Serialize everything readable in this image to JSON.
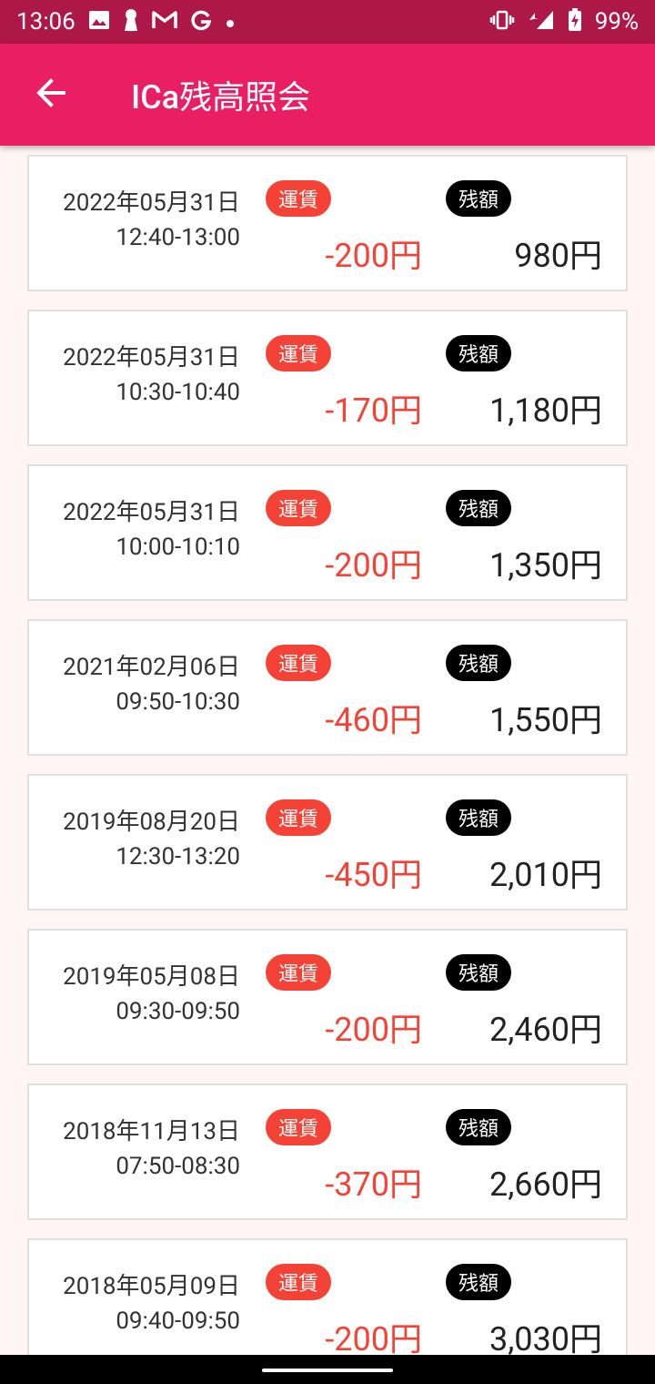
{
  "status_bar": {
    "time": "13:06",
    "battery": "99%",
    "left_icons": [
      "image-icon",
      "keyhole-icon",
      "gmail-icon",
      "google-icon",
      "dot-icon"
    ],
    "right_icons": [
      "vibrate-icon",
      "signal-icon",
      "battery-charging-icon"
    ]
  },
  "app_bar": {
    "title": "ICa残高照会",
    "back_icon": "arrow-left-icon"
  },
  "labels": {
    "fare": "運賃",
    "balance": "残額"
  },
  "colors": {
    "status_bar": "#ad1848",
    "app_bar": "#e91e63",
    "fare_red": "#f44336",
    "background": "#fff5f5"
  },
  "transactions": [
    {
      "date": "2022年05月31日",
      "time": "12:40-13:00",
      "fare": "-200円",
      "balance": "980円"
    },
    {
      "date": "2022年05月31日",
      "time": "10:30-10:40",
      "fare": "-170円",
      "balance": "1,180円"
    },
    {
      "date": "2022年05月31日",
      "time": "10:00-10:10",
      "fare": "-200円",
      "balance": "1,350円"
    },
    {
      "date": "2021年02月06日",
      "time": "09:50-10:30",
      "fare": "-460円",
      "balance": "1,550円"
    },
    {
      "date": "2019年08月20日",
      "time": "12:30-13:20",
      "fare": "-450円",
      "balance": "2,010円"
    },
    {
      "date": "2019年05月08日",
      "time": "09:30-09:50",
      "fare": "-200円",
      "balance": "2,460円"
    },
    {
      "date": "2018年11月13日",
      "time": "07:50-08:30",
      "fare": "-370円",
      "balance": "2,660円"
    },
    {
      "date": "2018年05月09日",
      "time": "09:40-09:50",
      "fare": "-200円",
      "balance": "3,030円"
    }
  ]
}
